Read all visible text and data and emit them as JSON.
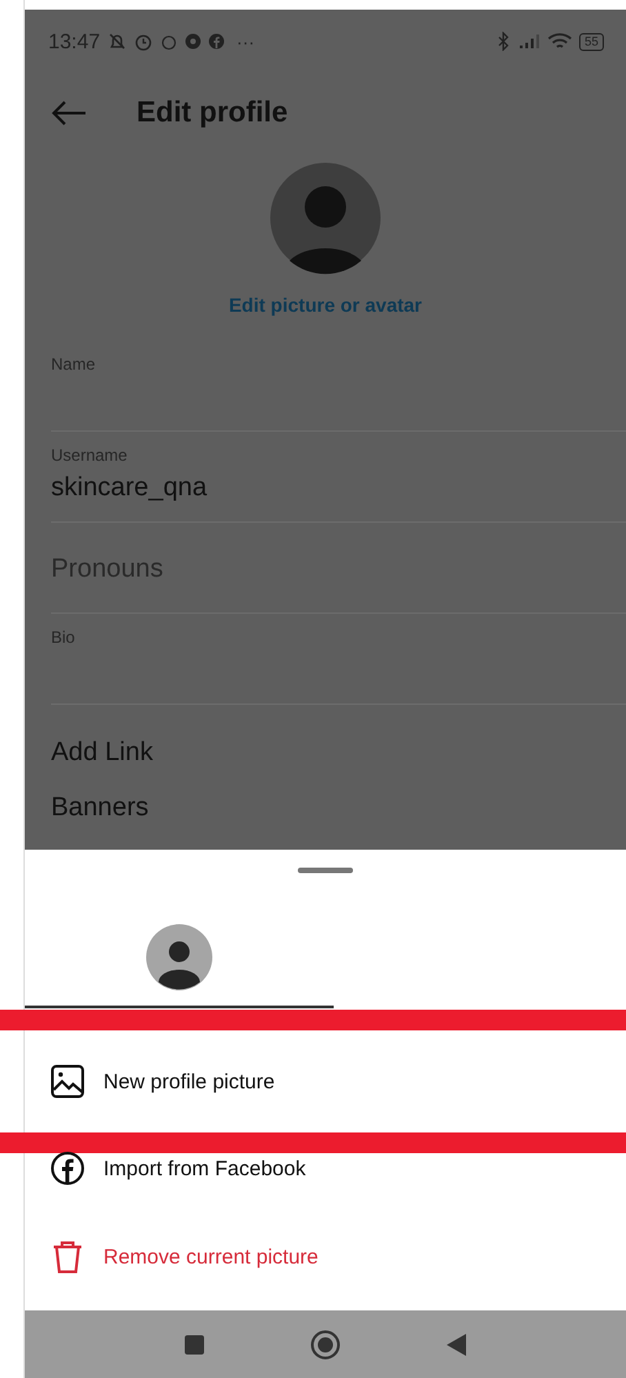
{
  "status_bar": {
    "time": "13:47",
    "dots": "···",
    "battery": "55"
  },
  "app_bar": {
    "title": "Edit profile"
  },
  "profile": {
    "edit_link": "Edit picture or avatar"
  },
  "fields": [
    {
      "kind": "field",
      "label": "Name"
    },
    {
      "kind": "field",
      "label": "Username",
      "value": "skincare_qna"
    },
    {
      "kind": "placeholder",
      "placeholder": "Pronouns"
    },
    {
      "kind": "field",
      "label": "Bio"
    },
    {
      "kind": "row",
      "label": "Add Link"
    },
    {
      "kind": "row",
      "label": "Banners"
    }
  ],
  "sheet": {
    "items": [
      {
        "kind": "picture",
        "label": "New profile picture",
        "highlighted": true
      },
      {
        "kind": "facebook",
        "label": "Import from Facebook",
        "highlighted": false
      },
      {
        "kind": "remove",
        "label": "Remove current picture",
        "highlighted": false
      }
    ]
  }
}
